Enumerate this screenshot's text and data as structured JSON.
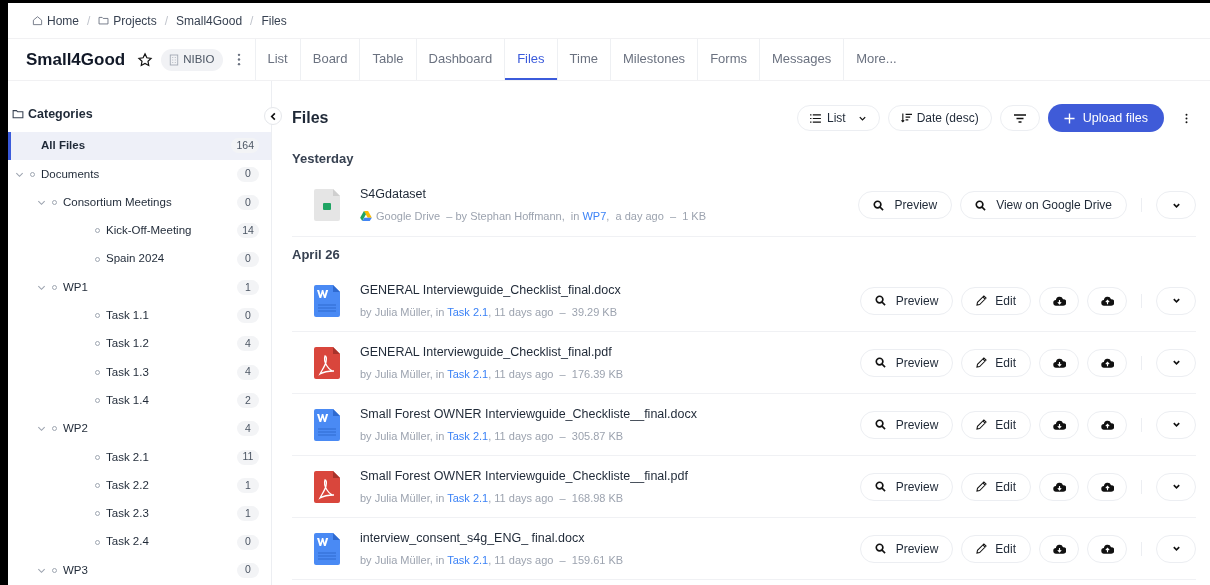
{
  "breadcrumb": [
    {
      "kind": "home",
      "label": "Home"
    },
    {
      "kind": "folder",
      "separator": "/",
      "label": "Projects"
    },
    {
      "kind": "plain",
      "separator": "/",
      "label": "Small4Good"
    },
    {
      "kind": "plain",
      "separator": "/",
      "label": "Files"
    }
  ],
  "project": {
    "title": "Small4Good",
    "starred": false,
    "org": "NIBIO"
  },
  "tabs": [
    {
      "label": "List",
      "selected": false
    },
    {
      "label": "Board",
      "selected": false
    },
    {
      "label": "Table",
      "selected": false
    },
    {
      "label": "Dashboard",
      "selected": false
    },
    {
      "label": "Files",
      "selected": true
    },
    {
      "label": "Time",
      "selected": false
    },
    {
      "label": "Milestones",
      "selected": false
    },
    {
      "label": "Forms",
      "selected": false
    },
    {
      "label": "Messages",
      "selected": false
    },
    {
      "label": "More...",
      "selected": false
    }
  ],
  "sidebar": {
    "title": "Categories",
    "items": [
      {
        "label": "All Files",
        "count": "164",
        "selected": true
      },
      {
        "label": "Documents",
        "count": "0",
        "selected": false,
        "expanded": true,
        "children": [
          {
            "label": "Consortium Meetings",
            "count": "0",
            "selected": false,
            "expanded": true,
            "children": [
              {
                "label": "Kick-Off-Meeting",
                "count": "14",
                "selected": false
              },
              {
                "label": "Spain 2024",
                "count": "0",
                "selected": false
              }
            ]
          },
          {
            "label": "WP1",
            "count": "1",
            "selected": false,
            "expanded": true,
            "children": [
              {
                "label": "Task 1.1",
                "count": "0",
                "selected": false
              },
              {
                "label": "Task 1.2",
                "count": "4",
                "selected": false
              },
              {
                "label": "Task 1.3",
                "count": "4",
                "selected": false
              },
              {
                "label": "Task 1.4",
                "count": "2",
                "selected": false
              }
            ]
          },
          {
            "label": "WP2",
            "count": "4",
            "selected": false,
            "expanded": true,
            "children": [
              {
                "label": "Task 2.1",
                "count": "11",
                "selected": false
              },
              {
                "label": "Task 2.2",
                "count": "1",
                "selected": false
              },
              {
                "label": "Task 2.3",
                "count": "1",
                "selected": false
              },
              {
                "label": "Task 2.4",
                "count": "0",
                "selected": false
              }
            ]
          },
          {
            "label": "WP3",
            "count": "0",
            "selected": false,
            "expanded": true
          }
        ]
      }
    ]
  },
  "main": {
    "title": "Files",
    "view": "List",
    "sort": "Date (desc)",
    "upload": "Upload files",
    "groups": [
      {
        "heading": "Yesterday",
        "files": [
          {
            "name": "S4Gdataset",
            "kind": "sheet",
            "source": "Google Drive",
            "meta_before": "– by Stephan Hoffmann,  in ",
            "link": "WP7",
            "meta_after": ",  a day ago  –  1 KB",
            "actions": [
              {
                "kind": "preview",
                "label": "Preview"
              },
              {
                "kind": "drive",
                "label": "View on Google Drive"
              }
            ]
          }
        ]
      },
      {
        "heading": "April 26",
        "files": [
          {
            "name": "GENERAL Interviewguide_Checklist_final.docx",
            "kind": "word",
            "meta_before": "by Julia Müller, in ",
            "link": "Task 2.1",
            "meta_after": ", 11 days ago  –  39.29 KB",
            "actions": [
              {
                "kind": "preview",
                "label": "Preview"
              },
              {
                "kind": "edit",
                "label": "Edit"
              },
              {
                "kind": "download"
              },
              {
                "kind": "upload"
              }
            ]
          },
          {
            "name": "GENERAL Interviewguide_Checklist_final.pdf",
            "kind": "pdf",
            "meta_before": "by Julia Müller, in ",
            "link": "Task 2.1",
            "meta_after": ", 11 days ago  –  176.39 KB",
            "actions": [
              {
                "kind": "preview",
                "label": "Preview"
              },
              {
                "kind": "edit",
                "label": "Edit"
              },
              {
                "kind": "download"
              },
              {
                "kind": "upload"
              }
            ]
          },
          {
            "name": "Small Forest OWNER Interviewguide_Checkliste__final.docx",
            "kind": "word",
            "meta_before": "by Julia Müller, in ",
            "link": "Task 2.1",
            "meta_after": ", 11 days ago  –  305.87 KB",
            "actions": [
              {
                "kind": "preview",
                "label": "Preview"
              },
              {
                "kind": "edit",
                "label": "Edit"
              },
              {
                "kind": "download"
              },
              {
                "kind": "upload"
              }
            ]
          },
          {
            "name": "Small Forest OWNER Interviewguide_Checkliste__final.pdf",
            "kind": "pdf",
            "meta_before": "by Julia Müller, in ",
            "link": "Task 2.1",
            "meta_after": ", 11 days ago  –  168.98 KB",
            "actions": [
              {
                "kind": "preview",
                "label": "Preview"
              },
              {
                "kind": "edit",
                "label": "Edit"
              },
              {
                "kind": "download"
              },
              {
                "kind": "upload"
              }
            ]
          },
          {
            "name": "interview_consent_s4g_ENG_ final.docx",
            "kind": "word",
            "meta_before": "by Julia Müller, in ",
            "link": "Task 2.1",
            "meta_after": ", 11 days ago  –  159.61 KB",
            "actions": [
              {
                "kind": "preview",
                "label": "Preview"
              },
              {
                "kind": "edit",
                "label": "Edit"
              },
              {
                "kind": "download"
              },
              {
                "kind": "upload"
              }
            ]
          }
        ]
      }
    ]
  }
}
